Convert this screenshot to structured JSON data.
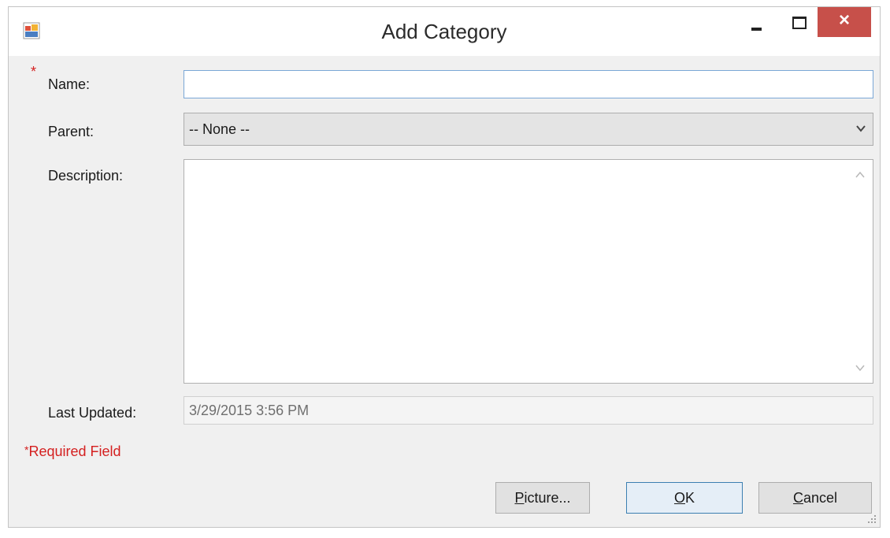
{
  "window": {
    "title": "Add Category",
    "icon": "form-window-icon",
    "controls": {
      "minimize": "minimize-icon",
      "maximize": "maximize-icon",
      "close": "×"
    }
  },
  "form": {
    "name": {
      "label": "Name:",
      "required_mark": "*",
      "value": ""
    },
    "parent": {
      "label": "Parent:",
      "selected": "-- None --"
    },
    "description": {
      "label": "Description:",
      "value": ""
    },
    "last_updated": {
      "label": "Last Updated:",
      "value": "3/29/2015 3:56 PM"
    }
  },
  "footer": {
    "required_star": "*",
    "required_text": "Required Field"
  },
  "buttons": {
    "picture": {
      "mnemonic": "P",
      "rest": "icture..."
    },
    "ok": {
      "mnemonic": "O",
      "rest": "K"
    },
    "cancel": {
      "mnemonic": "C",
      "rest": "ancel"
    }
  },
  "colors": {
    "required": "#d42020",
    "close_button": "#c7504a",
    "focus_border": "#7aa7d6"
  }
}
